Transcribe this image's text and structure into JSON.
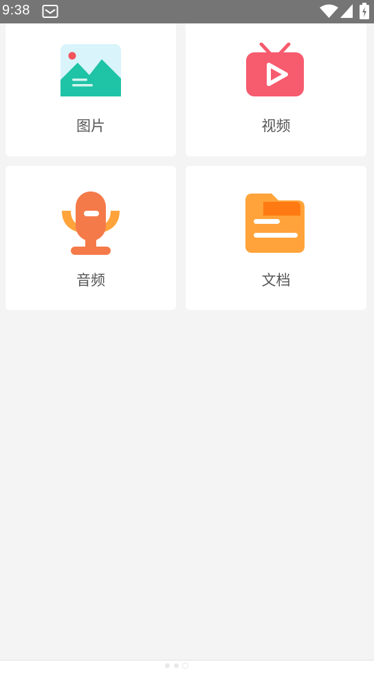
{
  "status_bar": {
    "time": "9:38",
    "icons": [
      "mail-icon",
      "wifi-icon",
      "cell-signal-icon",
      "battery-charging-icon"
    ]
  },
  "categories": [
    {
      "id": "images",
      "label": "图片",
      "icon": "image-icon",
      "color": "#1fc3a6"
    },
    {
      "id": "videos",
      "label": "视频",
      "icon": "video-tv-icon",
      "color": "#f75b6e"
    },
    {
      "id": "audio",
      "label": "音频",
      "icon": "microphone-icon",
      "color": "#f57a4a"
    },
    {
      "id": "documents",
      "label": "文档",
      "icon": "folder-document-icon",
      "color": "#ffa33a"
    }
  ],
  "pager": {
    "pages": 3,
    "active_index": 2
  },
  "colors": {
    "background": "#f4f4f4",
    "card": "#ffffff",
    "status_bar": "#757575",
    "label_text": "#555555"
  }
}
